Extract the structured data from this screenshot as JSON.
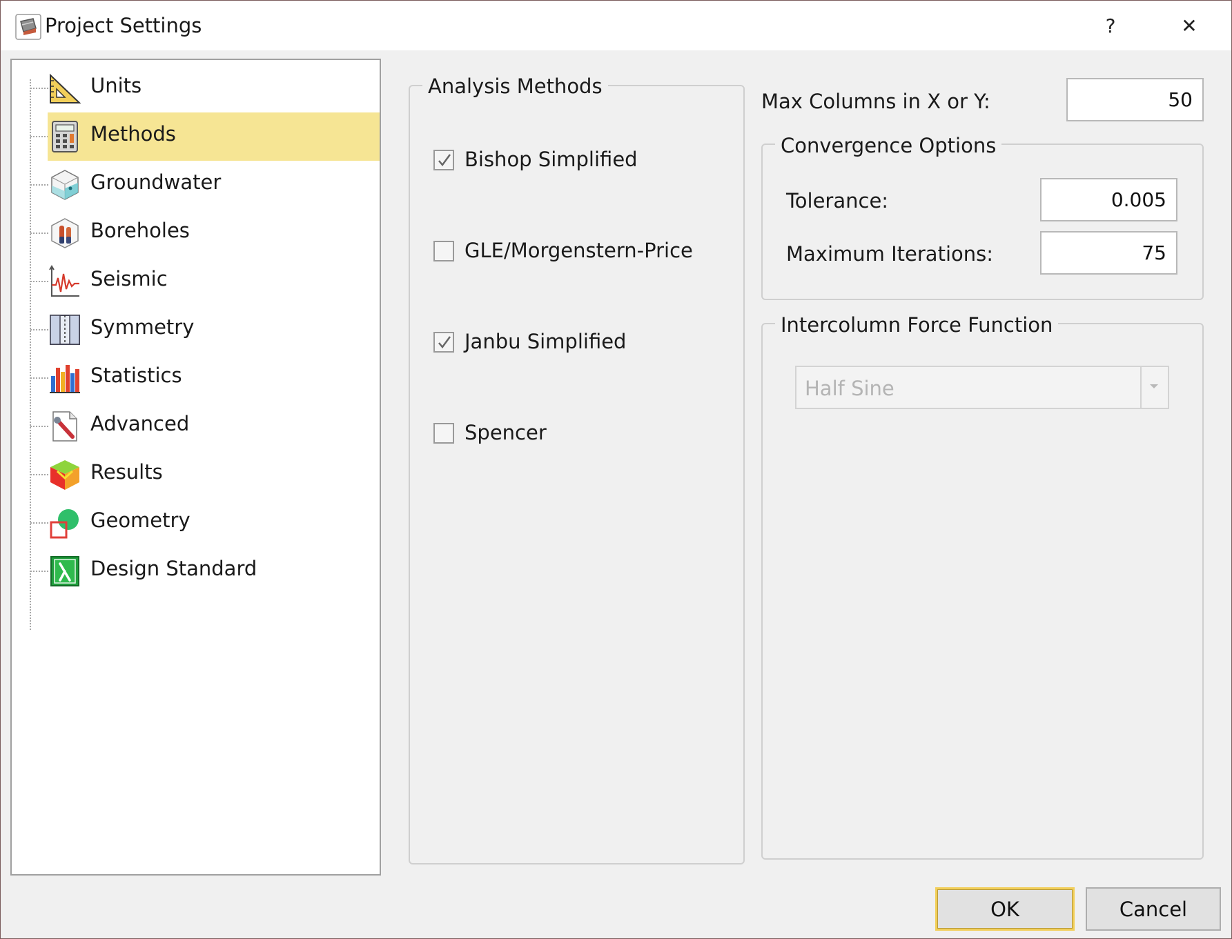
{
  "window": {
    "title": "Project Settings",
    "help_label": "?",
    "close_label": "✕"
  },
  "tree": {
    "items": [
      {
        "label": "Units",
        "icon": "set-square-icon",
        "selected": false
      },
      {
        "label": "Methods",
        "icon": "calculator-icon",
        "selected": true
      },
      {
        "label": "Groundwater",
        "icon": "groundwater-cube-icon",
        "selected": false
      },
      {
        "label": "Boreholes",
        "icon": "borehole-icon",
        "selected": false
      },
      {
        "label": "Seismic",
        "icon": "seismic-icon",
        "selected": false
      },
      {
        "label": "Symmetry",
        "icon": "symmetry-icon",
        "selected": false
      },
      {
        "label": "Statistics",
        "icon": "statistics-bars-icon",
        "selected": false
      },
      {
        "label": "Advanced",
        "icon": "advanced-wrench-icon",
        "selected": false
      },
      {
        "label": "Results",
        "icon": "results-cube-icon",
        "selected": false
      },
      {
        "label": "Geometry",
        "icon": "geometry-shapes-icon",
        "selected": false
      },
      {
        "label": "Design Standard",
        "icon": "lambda-icon",
        "selected": false
      }
    ]
  },
  "analysis": {
    "title": "Analysis Methods",
    "methods": [
      {
        "label": "Bishop Simplified",
        "checked": true
      },
      {
        "label": "GLE/Morgenstern-Price",
        "checked": false
      },
      {
        "label": "Janbu Simplified",
        "checked": true
      },
      {
        "label": "Spencer",
        "checked": false
      }
    ]
  },
  "settings": {
    "max_columns_label": "Max Columns in X or Y:",
    "max_columns_value": "50",
    "convergence": {
      "title": "Convergence Options",
      "tolerance_label": "Tolerance:",
      "tolerance_value": "0.005",
      "max_iterations_label": "Maximum Iterations:",
      "max_iterations_value": "75"
    },
    "intercolumn": {
      "title": "Intercolumn Force Function",
      "selected": "Half Sine",
      "enabled": false
    }
  },
  "buttons": {
    "ok": "OK",
    "cancel": "Cancel"
  },
  "colors": {
    "selection": "#f6e594",
    "default_button_border": "#f2cf5a"
  }
}
